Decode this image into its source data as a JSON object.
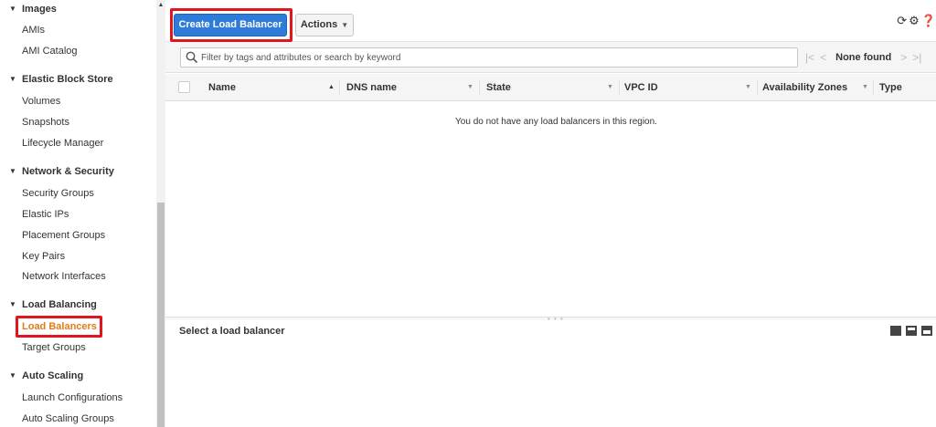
{
  "sidebar": {
    "sections": [
      {
        "label": "Images",
        "items": [
          "AMIs",
          "AMI Catalog"
        ]
      },
      {
        "label": "Elastic Block Store",
        "items": [
          "Volumes",
          "Snapshots",
          "Lifecycle Manager"
        ]
      },
      {
        "label": "Network & Security",
        "items": [
          "Security Groups",
          "Elastic IPs",
          "Placement Groups",
          "Key Pairs",
          "Network Interfaces"
        ]
      },
      {
        "label": "Load Balancing",
        "items": [
          "Load Balancers",
          "Target Groups"
        ]
      },
      {
        "label": "Auto Scaling",
        "items": [
          "Launch Configurations",
          "Auto Scaling Groups"
        ]
      }
    ],
    "active_item": "Load Balancers"
  },
  "toolbar": {
    "create_label": "Create Load Balancer",
    "actions_label": "Actions"
  },
  "filter": {
    "placeholder": "Filter by tags and attributes or search by keyword",
    "pager_label": "None found"
  },
  "table": {
    "columns": [
      "Name",
      "DNS name",
      "State",
      "VPC ID",
      "Availability Zones",
      "Type"
    ],
    "empty_message": "You do not have any load balancers in this region."
  },
  "details": {
    "title": "Select a load balancer"
  },
  "colors": {
    "primary_button": "#2f7cd8",
    "active_nav": "#e07b17",
    "highlight": "#e0161e"
  },
  "icons": [
    "search-icon",
    "refresh-icon",
    "settings-icon",
    "help-icon",
    "first-page-icon",
    "prev-page-icon",
    "next-page-icon",
    "last-page-icon"
  ]
}
